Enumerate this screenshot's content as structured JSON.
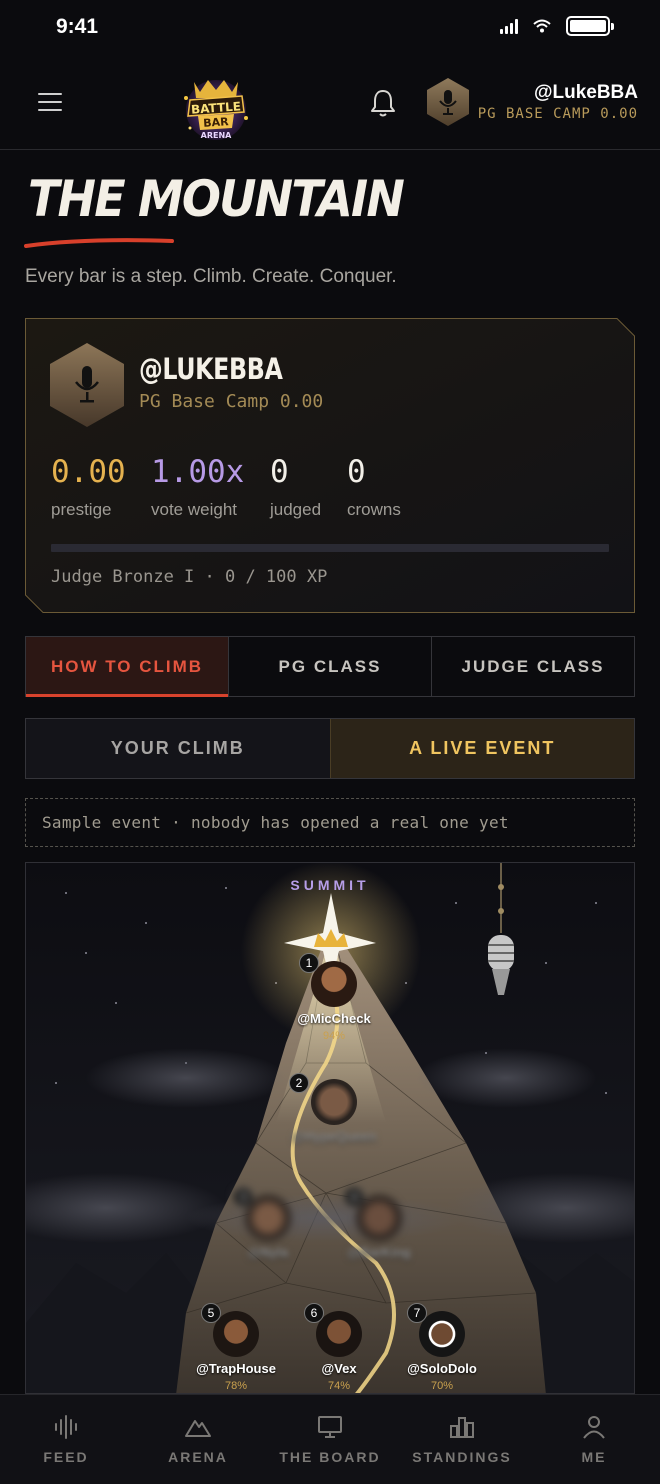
{
  "status": {
    "time": "9:41"
  },
  "header": {
    "username": "@LukeBBA",
    "rank": "PG BASE CAMP 0.00",
    "logo_text": [
      "BATTLE",
      "BAR",
      "ARENA"
    ]
  },
  "page": {
    "title": "THE MOUNTAIN",
    "tagline": "Every bar is a step. Climb. Create. Conquer."
  },
  "profile": {
    "name": "@LUKEBBA",
    "rank": "PG Base Camp 0.00",
    "stats": [
      {
        "value": "0.00",
        "label": "prestige",
        "color": "#e5b24f"
      },
      {
        "value": "1.00x",
        "label": "vote weight",
        "color": "#b79ae6"
      },
      {
        "value": "0",
        "label": "judged",
        "color": "#f2efe8"
      },
      {
        "value": "0",
        "label": "crowns",
        "color": "#f2efe8"
      }
    ],
    "xp_label": "Judge Bronze I · 0 / 100 XP",
    "xp_progress": 0
  },
  "tabs": [
    "HOW TO CLIMB",
    "PG CLASS",
    "JUDGE CLASS"
  ],
  "subtabs": [
    "YOUR CLIMB",
    "A LIVE EVENT"
  ],
  "sample_note": "Sample event · nobody has opened a real one yet",
  "mountain": {
    "summit_label": "SUMMIT",
    "climbers": [
      {
        "rank": "1",
        "handle": "@MicCheck",
        "pct": "94%"
      },
      {
        "rank": "2",
        "handle": "@HypeQueen",
        "pct": ""
      },
      {
        "rank": "3",
        "handle": "@Nyla",
        "pct": ""
      },
      {
        "rank": "4",
        "handle": "@BarKing",
        "pct": ""
      },
      {
        "rank": "5",
        "handle": "@TrapHouse",
        "pct": "78%"
      },
      {
        "rank": "6",
        "handle": "@Vex",
        "pct": "74%"
      },
      {
        "rank": "7",
        "handle": "@SoloDolo",
        "pct": "70%"
      }
    ]
  },
  "nav": [
    {
      "label": "FEED",
      "icon": "waveform-icon"
    },
    {
      "label": "ARENA",
      "icon": "mountain-icon"
    },
    {
      "label": "THE BOARD",
      "icon": "monitor-icon"
    },
    {
      "label": "STANDINGS",
      "icon": "bar-chart-icon"
    },
    {
      "label": "ME",
      "icon": "person-icon"
    }
  ],
  "colors": {
    "accent_red": "#d9432d",
    "gold": "#c9a24f",
    "purple": "#b79ae6"
  }
}
